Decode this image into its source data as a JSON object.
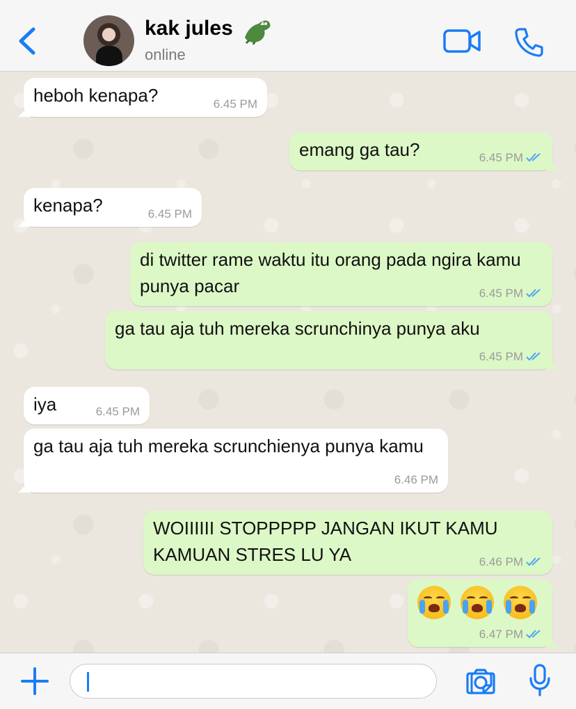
{
  "header": {
    "contact_name": "kak jules",
    "status": "online"
  },
  "colors": {
    "accent": "#1a7cf5",
    "outgoing_bubble": "#dcf8c6",
    "incoming_bubble": "#ffffff",
    "read_ticks": "#4fa3f7"
  },
  "messages": [
    {
      "direction": "in",
      "text": "heboh kenapa?",
      "time": "6.45 PM"
    },
    {
      "direction": "out",
      "text": "emang ga tau?",
      "time": "6.45 PM",
      "status": "read"
    },
    {
      "direction": "in",
      "text": "kenapa?",
      "time": "6.45 PM"
    },
    {
      "direction": "out",
      "text": "di twitter rame waktu itu orang pada ngira kamu punya pacar",
      "time": "6.45 PM",
      "status": "read"
    },
    {
      "direction": "out",
      "text": "ga tau aja tuh mereka scrunchinya punya aku",
      "time": "6.45 PM",
      "status": "read"
    },
    {
      "direction": "in",
      "text": "iya",
      "time": "6.45 PM"
    },
    {
      "direction": "in",
      "text": "ga tau aja tuh mereka scrunchienya punya kamu",
      "time": "6.46 PM"
    },
    {
      "direction": "out",
      "text": "WOIIIIII STOPPPPP JANGAN IKUT KAMU KAMUAN STRES LU YA",
      "time": "6.46 PM",
      "status": "read"
    },
    {
      "direction": "out",
      "emoji": [
        "loudly-crying-face",
        "loudly-crying-face",
        "loudly-crying-face"
      ],
      "time": "6.47 PM",
      "status": "read"
    }
  ],
  "composer": {
    "value": ""
  },
  "icons": [
    "back-chevron-icon",
    "crocodile-emoji-icon",
    "video-call-icon",
    "phone-call-icon",
    "plus-icon",
    "sticker-icon",
    "camera-icon",
    "microphone-icon",
    "double-check-icon"
  ]
}
